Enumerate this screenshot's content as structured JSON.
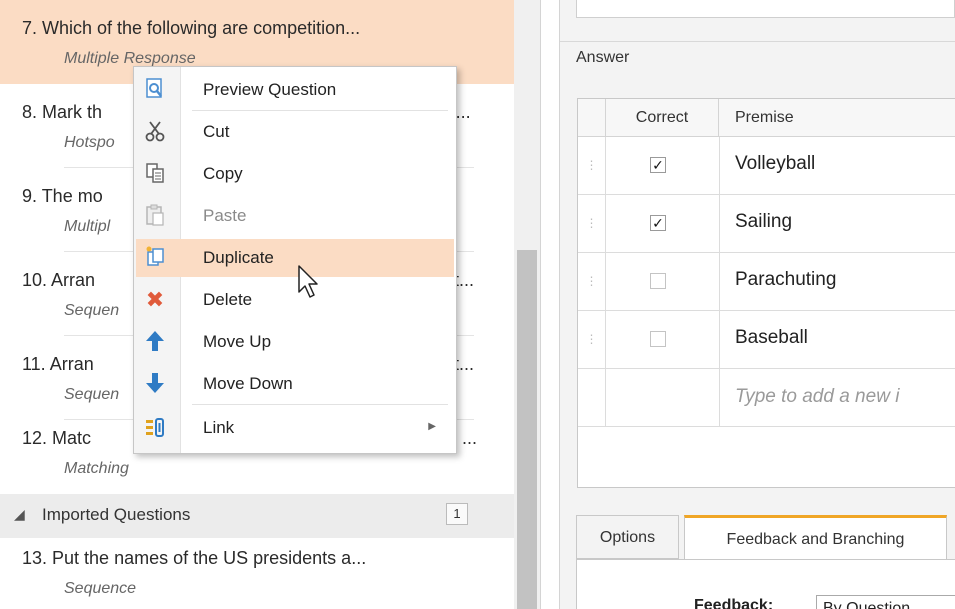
{
  "questions": [
    {
      "title": "7. Which of the following are competition...",
      "type": "Multiple Response"
    },
    {
      "title": "8. Mark th",
      "title_tail": "Vi...",
      "type": "Hotspo"
    },
    {
      "title": "9. The mo",
      "type": "Multipl"
    },
    {
      "title": "10. Arran",
      "title_tail": "t...",
      "type": "Sequen"
    },
    {
      "title": "11. Arran",
      "title_tail": "t...",
      "type": "Sequen"
    },
    {
      "title": "12.  Matc",
      "title_tail": "...",
      "type": "Matching"
    },
    {
      "title": "13. Put the names of the US presidents a...",
      "type": "Sequence"
    }
  ],
  "group": {
    "label": "Imported Questions",
    "count": "1"
  },
  "context_menu": {
    "items": [
      {
        "label": "Preview Question",
        "icon": "preview-icon"
      },
      {
        "label": "Cut",
        "icon": "scissors-icon"
      },
      {
        "label": "Copy",
        "icon": "copy-icon"
      },
      {
        "label": "Paste",
        "icon": "paste-icon",
        "disabled": true
      },
      {
        "label": "Duplicate",
        "icon": "duplicate-icon",
        "highlighted": true
      },
      {
        "label": "Delete",
        "icon": "delete-icon"
      },
      {
        "label": "Move Up",
        "icon": "arrow-up-icon"
      },
      {
        "label": "Move Down",
        "icon": "arrow-down-icon"
      },
      {
        "label": "Link",
        "icon": "link-icon",
        "submenu": true
      }
    ]
  },
  "answer": {
    "section_label": "Answer",
    "columns": [
      "Correct",
      "Premise"
    ],
    "rows": [
      {
        "correct": true,
        "premise": "Volleyball"
      },
      {
        "correct": true,
        "premise": "Sailing"
      },
      {
        "correct": false,
        "premise": "Parachuting"
      },
      {
        "correct": false,
        "premise": "Baseball"
      }
    ],
    "new_row_placeholder": "Type to add a new i"
  },
  "tabs": [
    {
      "label": "Options",
      "active": false
    },
    {
      "label": "Feedback and Branching",
      "active": true
    }
  ],
  "feedback": {
    "label": "Feedback:",
    "value": "By Question"
  },
  "colors": {
    "selection": "#fbdcc4",
    "active_tab_accent": "#f0a626",
    "delete": "#e05a3a",
    "arrow": "#2f7bc4"
  }
}
